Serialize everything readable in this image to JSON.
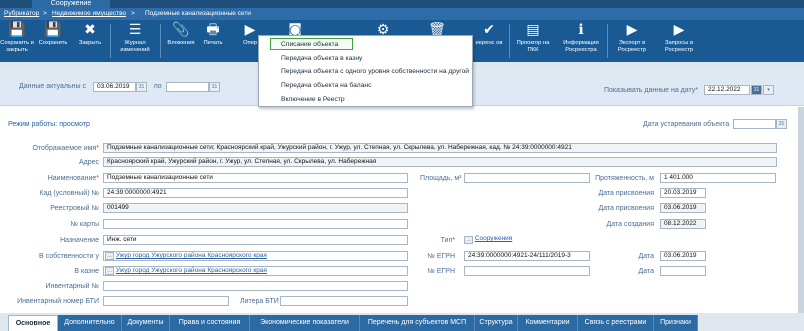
{
  "window": {
    "title": "Сооружение"
  },
  "breadcrumbs": [
    "Рубрикатор",
    "Недвижимое имущество",
    "Подземные канализационные сети"
  ],
  "breadcrumb_separator": ">",
  "toolbar": {
    "buttons": [
      {
        "label": "Сохранить и закрыть",
        "icon": "save-close-icon",
        "glyph": "💾"
      },
      {
        "label": "Сохранить",
        "icon": "save-icon",
        "glyph": "💾"
      },
      {
        "label": "Закрыть",
        "icon": "close-icon",
        "glyph": "✖"
      },
      {
        "label": "Журнал изменений",
        "icon": "journal-icon",
        "glyph": "☰"
      },
      {
        "label": "Вложения",
        "icon": "attachment-icon",
        "glyph": "📎"
      },
      {
        "label": "Печать",
        "icon": "print-icon",
        "glyph": "🖶"
      },
      {
        "label": "Опер",
        "icon": "operations-icon",
        "glyph": "▶"
      },
      {
        "label": "",
        "icon": "camera-icon",
        "glyph": "◙"
      },
      {
        "label": "",
        "icon": "settings-gear-icon",
        "glyph": "⚙"
      },
      {
        "label": "",
        "icon": "delete-icon",
        "glyph": "🗑"
      },
      {
        "label": "иеренс ов",
        "icon": "link-check-icon",
        "glyph": "✔"
      },
      {
        "label": "Проокгор на ПКК",
        "icon": "map-pkk-icon",
        "glyph": "▤"
      },
      {
        "label": "Информация Росреестра",
        "icon": "info-rosreestr-icon",
        "glyph": "ℹ"
      },
      {
        "label": "Экспорт в Росреестр",
        "icon": "export-icon",
        "glyph": "▶"
      },
      {
        "label": "Запросы в Росреестр",
        "icon": "requests-icon",
        "glyph": "▶"
      }
    ]
  },
  "dropdown_menu": {
    "items": [
      "Списание объекта",
      "Передача объекта в казну",
      "Передача объекта с одного уровня собственности на другой",
      "Передача объекта на баланс",
      "Включение в Реестр"
    ]
  },
  "dates_bar": {
    "actual_label": "Данные актуальны с",
    "from_value": "03.06.2019",
    "to_label": "по",
    "to_value": "",
    "show_label": "Показывать данные на дату*",
    "show_value": "22.12.2022",
    "calendar_glyph": "31",
    "dropdown_glyph": "▾"
  },
  "form": {
    "mode_label": "Режим работы: просмотр",
    "obsolete_label": "Дата устаревания объекта",
    "obsolete_value": "",
    "display_name_label": "Отображаемое имя",
    "display_name_value": "Подземные канализационные сети; Красноярский край, Ужурский район, г. Ужур, ул. Степная, ул. Скрылева, ул. Набережная, кад. № 24:39:0000000:4921",
    "address_label": "Адрес",
    "address_value": "Красноярский край, Ужурский район, г. Ужур, ул. Степная, ул. Скрылева, ул. Набережная",
    "name_label": "Наименование",
    "name_value": "Подземные канализационные сети",
    "area_label": "Площадь, м²",
    "area_value": "",
    "length_label": "Протяженность, м",
    "length_value": "1 401.000",
    "cad_label": "Кад (условный) №",
    "cad_value": "24:39:0000000:4921",
    "assign_date_label": "Дата присвоения",
    "assign_date_value": "20.03.2019",
    "reg_label": "Реестровый №",
    "reg_value": "001499",
    "assign_date2_label": "Дата присвоения",
    "assign_date2_value": "03.06.2019",
    "card_label": "№ карты",
    "card_value": "",
    "created_label": "Дата создания",
    "created_value": "08.12.2022",
    "purpose_label": "Назначение",
    "purpose_value": "Инж. сети",
    "type_label": "Тип",
    "type_value": "Сооружения",
    "ownership_label": "В собственности у",
    "ownership_value": "Ужур город Ужурского района Красноярского края",
    "egrn_label": "№ ЕГРН",
    "egrn_value": "24:39:0000000:4921-24/111/2019-3",
    "date_label": "Дата",
    "date_value": "03.06.2019",
    "treasury_label": "В казне",
    "treasury_value": "Ужур город Ужурского района Красноярского края",
    "egrn2_label": "№ ЕГРН",
    "egrn2_value": "",
    "date2_label": "Дата",
    "date2_value": "",
    "inventory_label": "Инвентарный №",
    "inventory_value": "",
    "bti_label": "Инвентарный номер БТИ",
    "bti_value": "",
    "bti_letter_label": "Литера БТИ",
    "bti_letter_value": "",
    "lookup_glyph": "…"
  },
  "tabs": [
    "Основное",
    "Дополнительно",
    "Документы",
    "Права и состояния",
    "Экономические показатели",
    "Перечень для субъектов МСП",
    "Структура",
    "Комментарии",
    "Связь с реестрами",
    "Признаки"
  ],
  "colors": {
    "toolbar": "#1a5a94",
    "breadcrumb": "#2d6ca8",
    "menu_highlight": "#3fa43f",
    "required": "#c0392b"
  }
}
